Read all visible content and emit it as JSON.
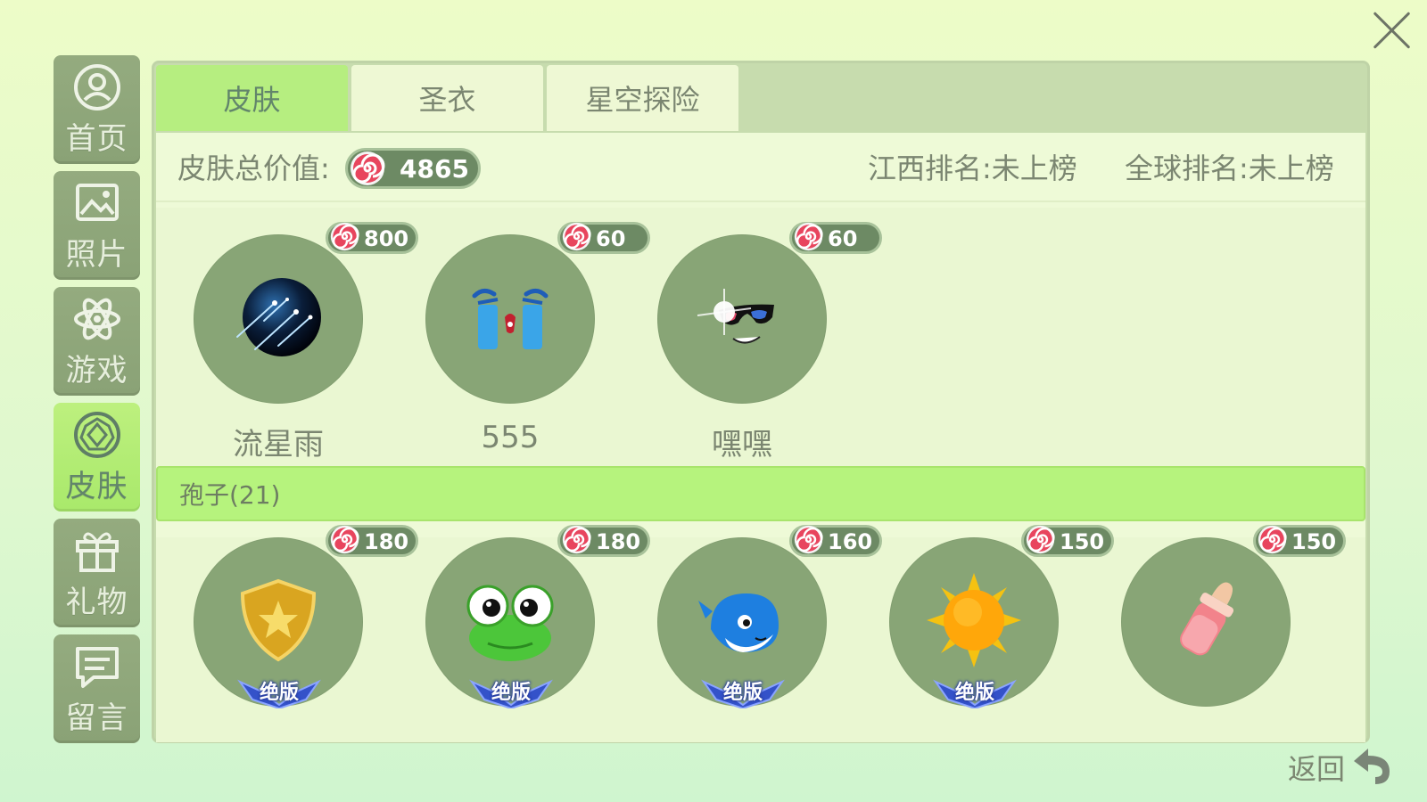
{
  "window": {
    "close_icon": "close-icon"
  },
  "sidebar": {
    "items": [
      {
        "label": "首页",
        "icon": "user-circle-icon"
      },
      {
        "label": "照片",
        "icon": "image-icon"
      },
      {
        "label": "游戏",
        "icon": "atom-icon"
      },
      {
        "label": "皮肤",
        "icon": "gem-circle-icon",
        "active": true
      },
      {
        "label": "礼物",
        "icon": "gift-icon"
      },
      {
        "label": "留言",
        "icon": "chat-icon"
      }
    ]
  },
  "tabs": [
    {
      "label": "皮肤",
      "active": true
    },
    {
      "label": "圣衣"
    },
    {
      "label": "星空探险"
    }
  ],
  "summary": {
    "total_label": "皮肤总价值:",
    "total_value": "4865",
    "rank_province": "江西排名:未上榜",
    "rank_global": "全球排名:未上榜"
  },
  "skins": [
    {
      "name": "流星雨",
      "price": "800",
      "icon": "meteor-shower-icon"
    },
    {
      "name": "555",
      "price": "60",
      "icon": "crying-face-icon"
    },
    {
      "name": "嘿嘿",
      "price": "60",
      "icon": "sunglasses-face-icon"
    }
  ],
  "spores": {
    "section_label": "孢子(21)",
    "items": [
      {
        "price": "180",
        "icon": "shield-icon",
        "badge": "绝版"
      },
      {
        "price": "180",
        "icon": "frog-icon",
        "badge": "绝版"
      },
      {
        "price": "160",
        "icon": "whale-icon",
        "badge": "绝版"
      },
      {
        "price": "150",
        "icon": "sun-icon",
        "badge": "绝版"
      },
      {
        "price": "150",
        "icon": "baby-bottle-icon"
      }
    ]
  },
  "footer": {
    "back_label": "返回"
  },
  "colors": {
    "accent": "#b6f37d",
    "sidebar": "#8aa276",
    "candy": "#e8455e"
  }
}
